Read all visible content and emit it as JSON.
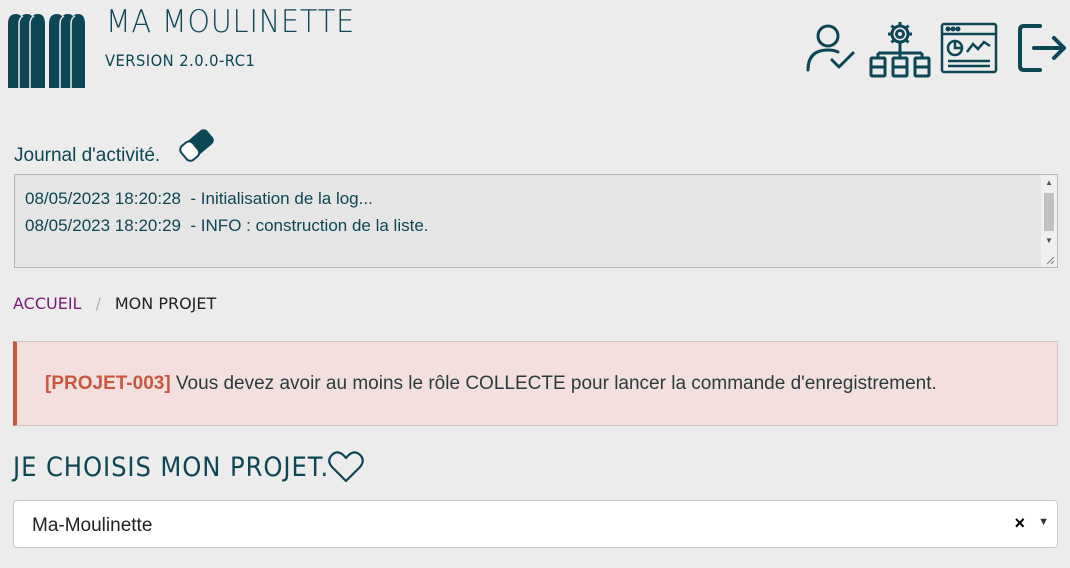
{
  "header": {
    "title": "MA MOULINETTE",
    "version": "VERSION 2.0.0-RC1",
    "icons": [
      "user-check-icon",
      "network-settings-icon",
      "dashboard-chart-icon",
      "logout-icon"
    ]
  },
  "journal": {
    "title": "Journal d'activité.",
    "eraser_icon": "eraser-icon",
    "lines": [
      "08/05/2023 18:20:28  - Initialisation de la log...",
      "08/05/2023 18:20:29  - INFO : construction de la liste."
    ]
  },
  "breadcrumb": {
    "home": "ACCUEIL",
    "separator": "/",
    "current": "MON PROJET"
  },
  "alert": {
    "code": "[PROJET-003]",
    "message": " Vous devez avoir au moins le rôle COLLECTE pour lancer la commande d'enregistrement."
  },
  "section": {
    "title": "JE CHOISIS MON PROJET.",
    "heart_icon": "heart-icon"
  },
  "project_select": {
    "value": "Ma-Moulinette",
    "clear": "×",
    "caret": "▼"
  },
  "colors": {
    "primary": "#0d4655",
    "background": "#ececec",
    "link": "#7a1b7a",
    "alert_accent": "#c9573f",
    "alert_bg": "#f3e0de"
  }
}
